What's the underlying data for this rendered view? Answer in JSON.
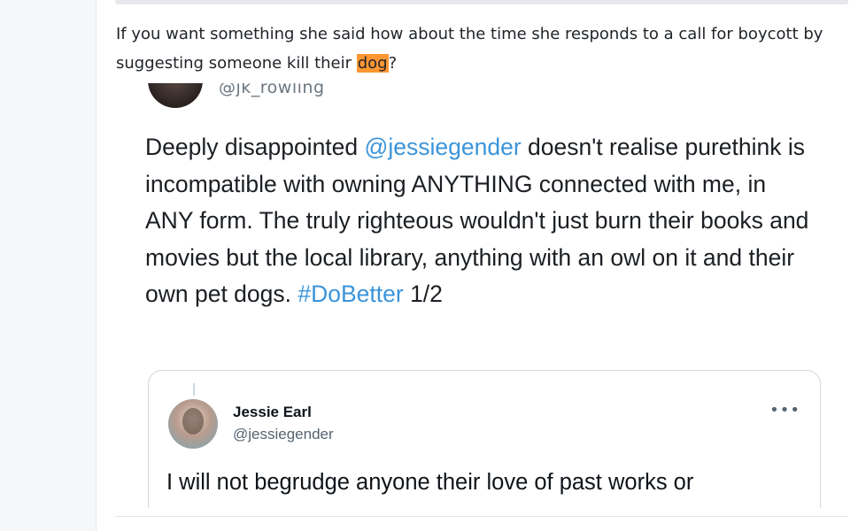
{
  "comment": {
    "text_before": "If you want something she said how about the time she responds to a call for boycott by suggesting someone kill their ",
    "highlight": "dog",
    "text_after": "?"
  },
  "tweet": {
    "handle_partial": "@jk_rowling",
    "body_1": "Deeply disappointed ",
    "mention": "@jessiegender",
    "body_2": " doesn't realise purethink is incompatible with owning ANYTHING connected with me, in ANY form. The truly righteous wouldn't just burn their books and movies but the local library, anything with an owl on it and their own pet dogs. ",
    "hashtag": "#DoBetter",
    "body_3": " 1/2"
  },
  "quoted_tweet": {
    "name": "Jessie Earl",
    "handle": "@jessiegender",
    "more_icon": "more-dots-icon",
    "more_glyph": "•••",
    "text": "I will not begrudge anyone their love of past works or"
  },
  "colors": {
    "highlight": "#ff9632",
    "link": "#3b94d9"
  }
}
